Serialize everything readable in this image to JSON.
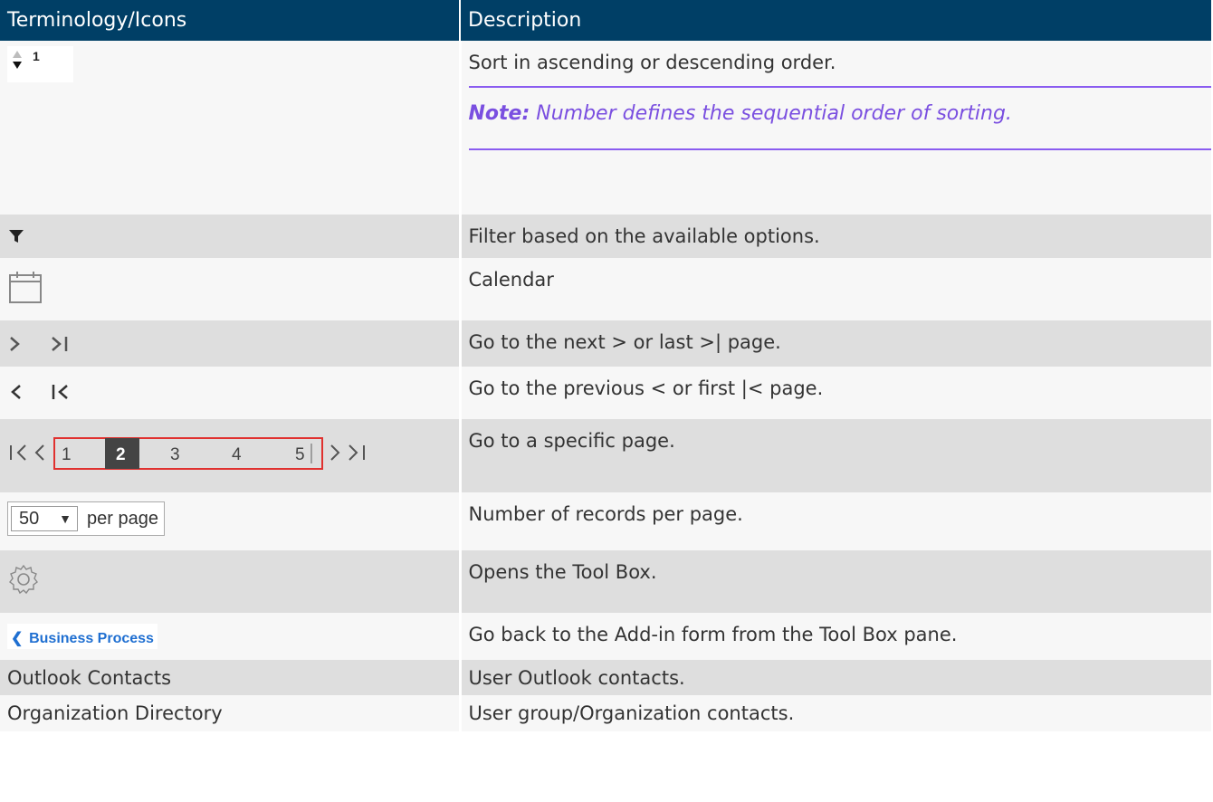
{
  "header": {
    "col1": "Terminology/Icons",
    "col2": "Description"
  },
  "rows": [
    {
      "icon": "sort-arrows-icon",
      "sort_number": "1",
      "desc": "Sort in ascending or descending order.",
      "note_label": "Note:",
      "note_text": " Number defines the sequential order of sorting."
    },
    {
      "icon": "filter-icon",
      "desc": "Filter based on the available options."
    },
    {
      "icon": "calendar-icon",
      "desc": "Calendar"
    },
    {
      "icon": "next-last-icons",
      "desc": "Go to the next > or last >| page."
    },
    {
      "icon": "previous-first-icons",
      "desc": "Go to the previous < or first |< page."
    },
    {
      "icon": "pagination-icon",
      "pages": [
        "1",
        "2",
        "3",
        "4",
        "5"
      ],
      "current_page": "2",
      "desc": "Go to a specific page."
    },
    {
      "icon": "per-page-select",
      "per_page_value": "50",
      "per_page_label": "per page",
      "desc": "Number of records per page."
    },
    {
      "icon": "gear-icon",
      "desc": "Opens the Tool Box."
    },
    {
      "icon": "back-chevron-icon",
      "back_label": "Business Process",
      "desc": "Go back to the Add-in form from the Tool Box pane."
    },
    {
      "term": "Outlook Contacts",
      "desc": "User Outlook contacts."
    },
    {
      "term": "Organization Directory",
      "desc": "User group/Organization contacts."
    }
  ],
  "colors": {
    "header_bg": "#003f66",
    "note": "#7a4fe0",
    "link": "#1f6fd1",
    "row_light": "#f7f7f7",
    "row_gray": "#dedede",
    "pager_box": "#e0312f"
  }
}
